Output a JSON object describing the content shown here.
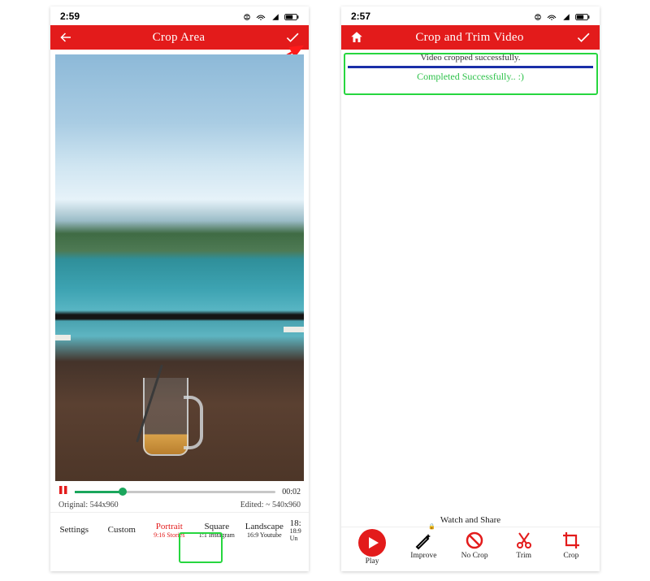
{
  "left": {
    "statusbar": {
      "time": "2:59"
    },
    "header": {
      "title": "Crop Area"
    },
    "timeline": {
      "time": "00:02"
    },
    "dims": {
      "original": "Original: 544x960",
      "edited": "Edited: ~ 540x960"
    },
    "ratios": [
      {
        "t1": "Settings",
        "t2": ""
      },
      {
        "t1": "Custom",
        "t2": ""
      },
      {
        "t1": "Portrait",
        "t2": "9:16 Stories",
        "selected": true
      },
      {
        "t1": "Square",
        "t2": "1:1 Instagram"
      },
      {
        "t1": "Landscape",
        "t2": "16:9 Youtube"
      },
      {
        "t1": "18:",
        "t2": "18:9 Un"
      }
    ]
  },
  "right": {
    "statusbar": {
      "time": "2:57"
    },
    "header": {
      "title": "Crop and Trim Video"
    },
    "success": {
      "line1": "Video cropped successfully.",
      "line2": "Completed Successfully.. :)"
    },
    "watchshare": {
      "title": "Watch and Share",
      "items": [
        {
          "label": "Play",
          "icon": "play"
        },
        {
          "label": "Improve",
          "icon": "wand"
        },
        {
          "label": "No Crop",
          "icon": "nocrop"
        },
        {
          "label": "Trim",
          "icon": "scissors"
        },
        {
          "label": "Crop",
          "icon": "crop"
        }
      ]
    }
  }
}
